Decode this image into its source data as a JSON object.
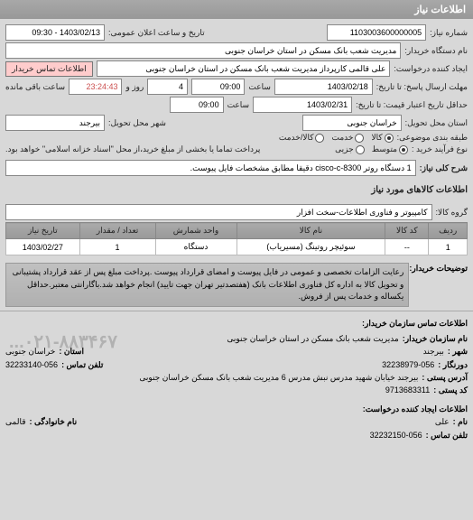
{
  "panel_title": "اطلاعات نیاز",
  "fields": {
    "request_no_label": "شماره نیاز:",
    "request_no": "1103003600000005",
    "public_date_label": "تاریخ و ساعت اعلان عمومی:",
    "public_date": "1403/02/13 - 09:30",
    "org_label": "نام دستگاه خریدار:",
    "org": "مدیریت شعب بانک مسکن در استان خراسان جنوبی",
    "creator_label": "ایجاد کننده درخواست:",
    "creator": "علی قالمی کارپرداز مدیریت شعب بانک مسکن در استان خراسان جنوبی",
    "contact_btn": "اطلاعات تماس خریدار",
    "deadline_label": "مهلت ارسال پاسخ: تا تاریخ:",
    "deadline_date": "1403/02/18",
    "deadline_time_label": "ساعت",
    "deadline_time": "09:00",
    "remain_days": "4",
    "remain_days_label": "روز و",
    "remain_time": "23:24:43",
    "remain_suffix": "ساعت باقی مانده",
    "min_deadline_label": "حداقل تاریخ اعتبار قیمت: تا تاریخ:",
    "min_deadline_date": "1403/02/31",
    "min_deadline_time": "09:00",
    "province_label": "استان محل تحویل:",
    "province": "خراسان جنوبی",
    "city_label": "شهر محل تحویل:",
    "city": "بیرجند",
    "pkg_label": "طبقه بندی موضوعی:",
    "pkg_opts": {
      "goods": "کالا",
      "service": "خدمت",
      "goods_service": "کالا/خدمت"
    },
    "buy_label": "نوع فرآیند خرید :",
    "buy_opts": {
      "mid": "متوسط",
      "small": "جزیی"
    },
    "buy_note": "پرداخت تماما یا بخشی از مبلغ خرید،از محل \"اسناد خزانه اسلامی\" خواهد بود.",
    "summary_label": "شرح کلی نیاز:",
    "summary": "1 دستگاه روتر cisco-c-8300 دقیقا مطابق مشخصات فایل پیوست."
  },
  "goods_title": "اطلاعات کالاهای مورد نیاز",
  "goods_group_label": "گروه کالا:",
  "goods_group": "کامپیوتر و فناوری اطلاعات-سخت افزار",
  "table": {
    "headers": [
      "ردیف",
      "کد کالا",
      "نام کالا",
      "واحد شمارش",
      "تعداد / مقدار",
      "تاریخ نیاز"
    ],
    "rows": [
      {
        "idx": "1",
        "code": "--",
        "name": "سوئیچر روتینگ (مسیریاب)",
        "unit": "دستگاه",
        "qty": "1",
        "date": "1403/02/27"
      }
    ]
  },
  "notes": {
    "label": "توضیحات خریدار:",
    "text": "رعایت الزامات تخصصی و عمومی در فایل پیوست و امضای قرارداد پیوست .پرداخت مبلغ پس از عقد قرارداد پشتیبانی و تحویل کالا به اداره کل فناوری اطلاعات بانک (هفتصدتیر تهران جهت تایید) انجام خواهد شد.باگارانتی معتبر.حداقل یکساله و خدمات پس از فروش."
  },
  "contact_title": "اطلاعات تماس سازمان خریدار:",
  "contact": {
    "org_label": "نام سازمان خریدار:",
    "org": "مدیریت شعب بانک مسکن در استان خراسان جنوبی",
    "city_label": "شهر :",
    "city": "بیرجند",
    "province_label": "استان :",
    "province": "خراسان جنوبی",
    "fax_label": "دورنگار :",
    "fax": "32238979-056",
    "phone_label": "تلفن تماس :",
    "phone": "32233140-056",
    "address_label": "آدرس پستی :",
    "address": "بیرجند خیابان شهید مدرس نبش مدرس 6 مدیریت شعب بانک مسکن خراسان جنوبی",
    "postal_label": "کد پستی :",
    "postal": "9713683311"
  },
  "requester_title": "اطلاعات ایجاد کننده درخواست:",
  "requester": {
    "name_label": "نام :",
    "name": "علی",
    "lname_label": "نام خانوادگی :",
    "lname": "قالمی",
    "phone_label": "تلفن تماس :",
    "phone": "32232150-056"
  },
  "watermark": "۰۲۱-۸۸۳۴۶۷..."
}
